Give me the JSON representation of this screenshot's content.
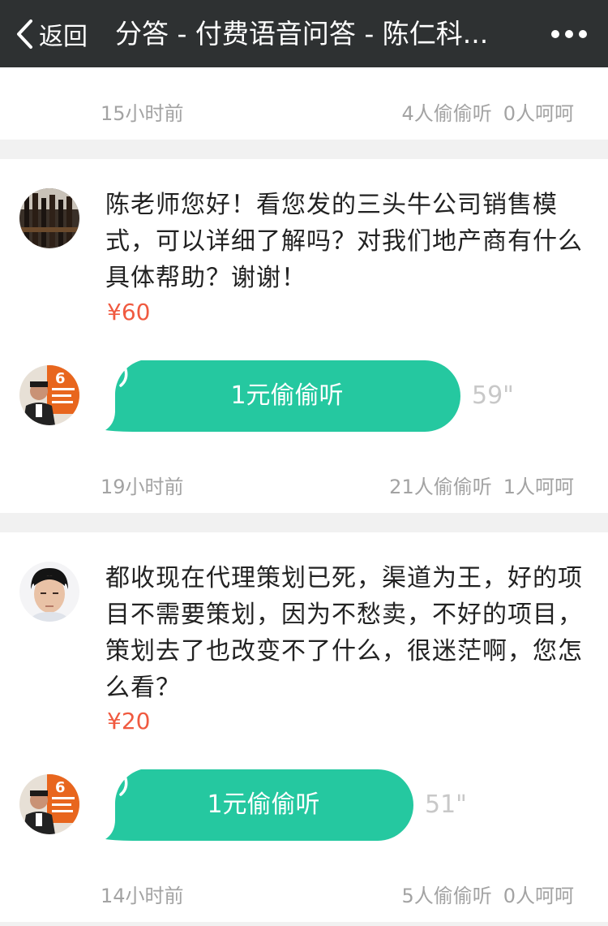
{
  "nav": {
    "back_label": "返回",
    "title": "分答 - 付费语音问答 - 陈仁科..."
  },
  "items": [
    {
      "time": "15小时前",
      "listeners": "4人偷偷听",
      "likes": "0人呵呵"
    },
    {
      "question": "陈老师您好！看您发的三头牛公司销售模式，可以详细了解吗？对我们地产商有什么具体帮助？谢谢！",
      "price": "¥60",
      "voice_label": "1元偷偷听",
      "duration": "59\"",
      "time": "19小时前",
      "listeners": "21人偷偷听",
      "likes": "1人呵呵"
    },
    {
      "question": "都收现在代理策划已死，渠道为王，好的项目不需要策划，因为不愁卖，不好的项目，策划去了也改变不了什么，很迷茫啊，您怎么看？",
      "price": "¥20",
      "voice_label": "1元偷偷听",
      "duration": "51\"",
      "time": "14小时前",
      "listeners": "5人偷偷听",
      "likes": "0人呵呵"
    }
  ],
  "colors": {
    "nav_bg": "#2e3132",
    "bubble": "#25c8a0",
    "price": "#f05a40",
    "meta": "#a3a3a3"
  }
}
